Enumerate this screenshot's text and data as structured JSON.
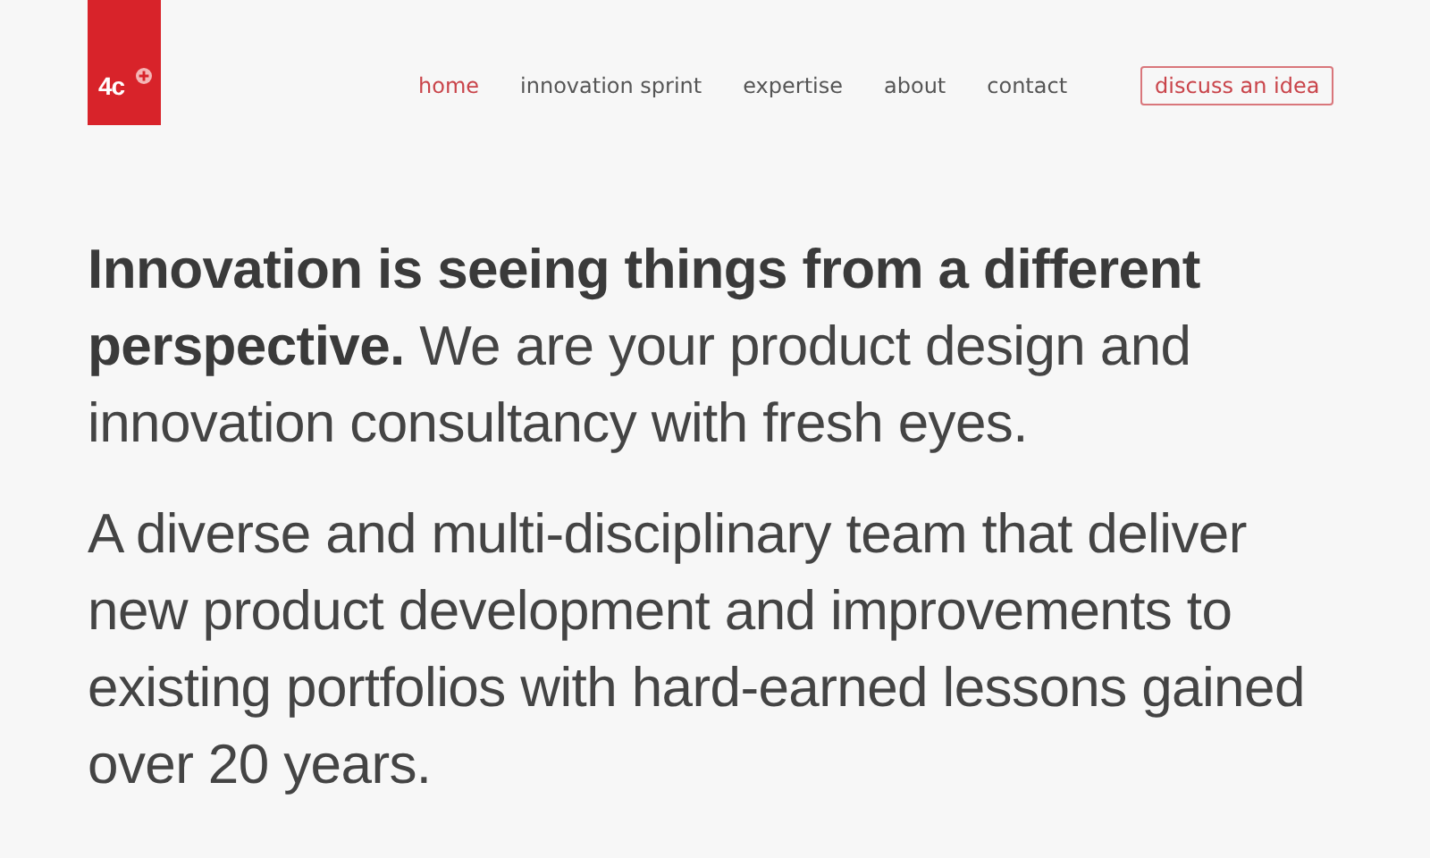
{
  "logo": {
    "text": "4c"
  },
  "nav": [
    {
      "label": "home",
      "selected": true
    },
    {
      "label": "innovation sprint",
      "selected": false
    },
    {
      "label": "expertise",
      "selected": false
    },
    {
      "label": "about",
      "selected": false
    },
    {
      "label": "contact",
      "selected": false
    }
  ],
  "cta_button": {
    "label": "discuss an idea"
  },
  "intro": "**Innovation is seeing things from a different perspective.** We are your product design and innovation consultancy with fresh eyes.",
  "body": "A diverse and multi-disciplinary team that deliver new product development and improvements to existing portfolios with hard-earned lessons gained over 20 years."
}
